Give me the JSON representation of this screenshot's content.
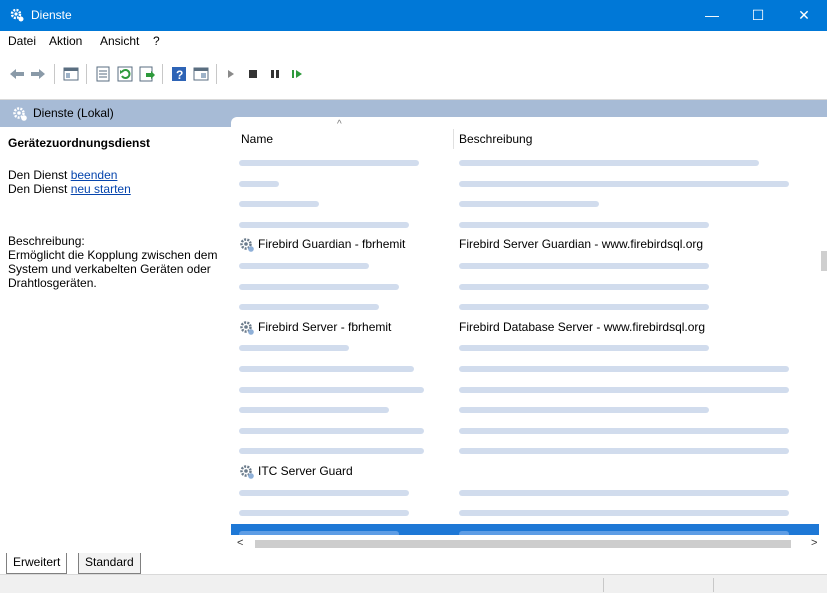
{
  "window": {
    "title": "Dienste",
    "minimize": "—",
    "maximize": "☐",
    "close": "✕"
  },
  "menu": [
    "Datei",
    "Aktion",
    "Ansicht",
    "?"
  ],
  "toolbar_icons": [
    "back-arrow-icon",
    "forward-arrow-icon",
    "console-tree-icon",
    "properties-icon",
    "refresh-icon",
    "export-icon",
    "help-icon",
    "console-icon",
    "start-icon",
    "stop-icon",
    "pause-icon",
    "resume-icon"
  ],
  "panel": {
    "title": "Dienste (Lokal)"
  },
  "left": {
    "service_name": "Gerätezuordnungsdienst",
    "stop_prefix": "Den Dienst ",
    "stop_link": "beenden",
    "restart_prefix": "Den Dienst ",
    "restart_link": "neu starten",
    "desc_label": "Beschreibung:",
    "desc_text": "Ermöglicht die Kopplung zwischen dem System und verkabelten Geräten oder Drahtlosgeräten."
  },
  "list": {
    "col_name": "Name",
    "col_desc": "Beschreibung",
    "rows": [
      {
        "name": "",
        "desc": "",
        "blurred": true,
        "nw": 180,
        "dw": 300
      },
      {
        "name": "",
        "desc": "",
        "blurred": true,
        "nw": 40,
        "dw": 330
      },
      {
        "name": "",
        "desc": "",
        "blurred": true,
        "nw": 80,
        "dw": 140
      },
      {
        "name": "",
        "desc": "",
        "blurred": true,
        "nw": 170,
        "dw": 250
      },
      {
        "name": "Firebird Guardian - fbrhemit",
        "desc": "Firebird Server Guardian - www.firebirdsql.org",
        "blurred": false
      },
      {
        "name": "",
        "desc": "",
        "blurred": true,
        "nw": 130,
        "dw": 250
      },
      {
        "name": "",
        "desc": "",
        "blurred": true,
        "nw": 160,
        "dw": 250
      },
      {
        "name": "",
        "desc": "",
        "blurred": true,
        "nw": 140,
        "dw": 250
      },
      {
        "name": "Firebird Server - fbrhemit",
        "desc": "Firebird Database Server - www.firebirdsql.org",
        "blurred": false
      },
      {
        "name": "",
        "desc": "",
        "blurred": true,
        "nw": 110,
        "dw": 250
      },
      {
        "name": "",
        "desc": "",
        "blurred": true,
        "nw": 175,
        "dw": 330
      },
      {
        "name": "",
        "desc": "",
        "blurred": true,
        "nw": 185,
        "dw": 330
      },
      {
        "name": "",
        "desc": "",
        "blurred": true,
        "nw": 150,
        "dw": 250
      },
      {
        "name": "",
        "desc": "",
        "blurred": true,
        "nw": 185,
        "dw": 330
      },
      {
        "name": "",
        "desc": "",
        "blurred": true,
        "nw": 185,
        "dw": 330
      },
      {
        "name": "ITC Server Guard",
        "desc": "",
        "blurred": false
      },
      {
        "name": "",
        "desc": "",
        "blurred": true,
        "nw": 170,
        "dw": 330
      },
      {
        "name": "",
        "desc": "",
        "blurred": true,
        "nw": 170,
        "dw": 330
      },
      {
        "name": "",
        "desc": "",
        "blurred": true,
        "nw": 160,
        "dw": 330,
        "selected": true
      }
    ]
  },
  "tabs": [
    "Erweitert",
    "Standard"
  ]
}
